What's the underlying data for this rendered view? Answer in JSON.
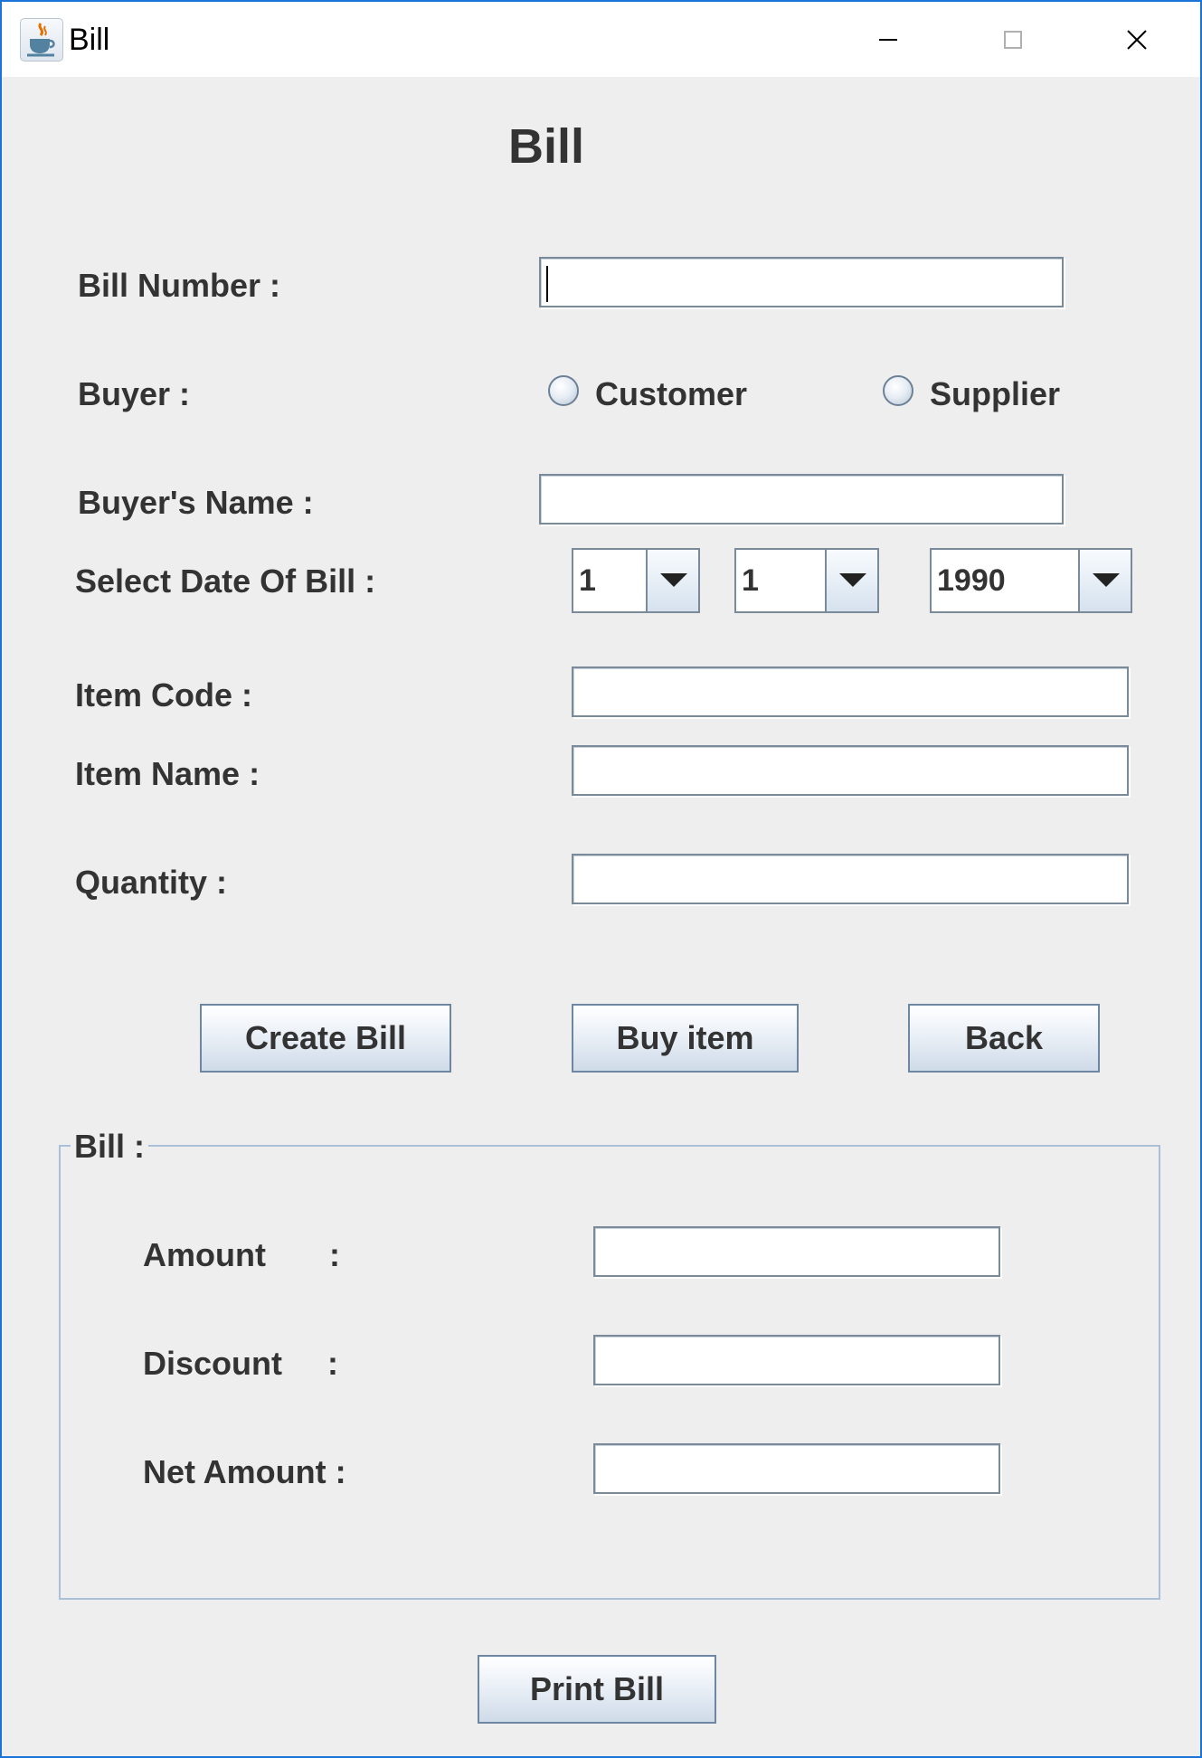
{
  "window": {
    "title": "Bill",
    "controls": [
      "minimize",
      "maximize",
      "close"
    ]
  },
  "form": {
    "title": "Bill",
    "bill_number_label": "Bill Number :",
    "bill_number_value": "",
    "buyer_label": "Buyer :",
    "buyer_options": [
      {
        "label": "Customer",
        "selected": false
      },
      {
        "label": "Supplier",
        "selected": false
      }
    ],
    "buyers_name_label": "Buyer's Name :",
    "buyers_name_value": "",
    "date_label": "Select Date Of Bill :",
    "date_day": "1",
    "date_month": "1",
    "date_year": "1990",
    "item_code_label": "Item Code :",
    "item_code_value": "",
    "item_name_label": "Item Name :",
    "item_name_value": "",
    "quantity_label": "Quantity :",
    "quantity_value": ""
  },
  "buttons": {
    "create_bill": "Create Bill",
    "buy_item": "Buy item",
    "back": "Back",
    "print_bill": "Print Bill"
  },
  "bill_section": {
    "title": "Bill :",
    "amount_label": "Amount       :",
    "amount_value": "",
    "discount_label": "Discount     :",
    "discount_value": "",
    "net_amount_label": "Net Amount :",
    "net_amount_value": ""
  },
  "colors": {
    "window_border": "#1a73d9",
    "background": "#eeeeee",
    "text": "#333333",
    "group_border": "#a9c0d8"
  },
  "icons": {
    "app": "java-coffee-cup-icon",
    "minimize": "minimize-icon",
    "maximize": "maximize-icon",
    "close": "close-icon",
    "dropdown": "triangle-down-icon"
  }
}
